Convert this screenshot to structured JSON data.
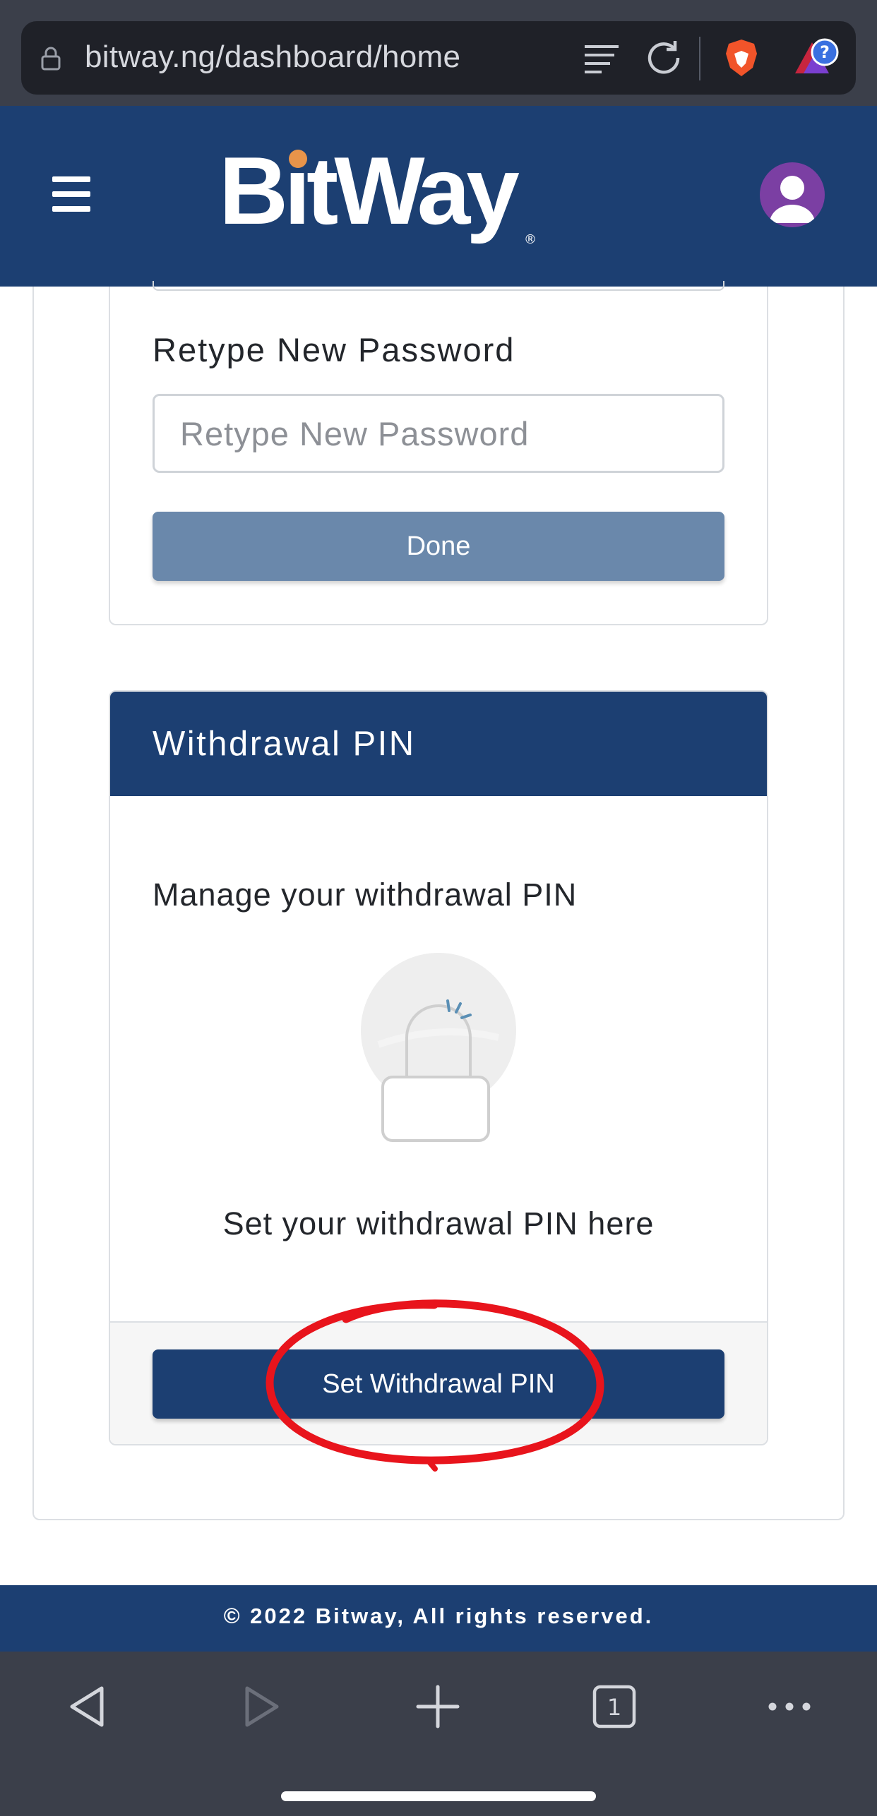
{
  "browser": {
    "url": "bitway.ng/dashboard/home",
    "tabs_count": "1"
  },
  "header": {
    "logo_text": "BitWay",
    "menu_icon": "hamburger-menu-icon",
    "avatar_icon": "user-avatar-icon"
  },
  "password_form": {
    "retype_label": "Retype New Password",
    "retype_placeholder": "Retype New Password",
    "retype_value": "",
    "done_label": "Done"
  },
  "withdrawal_pin": {
    "title": "Withdrawal PIN",
    "subtitle": "Manage your withdrawal PIN",
    "description": "Set your withdrawal PIN here",
    "button_label": "Set Withdrawal PIN",
    "illustration_icon": "padlock-icon"
  },
  "footer": {
    "copyright": "© 2022 Bitway, All rights reserved."
  },
  "colors": {
    "brand_navy": "#1c3f72",
    "done_button": "#6a88ab",
    "logo_accent": "#e8944a",
    "avatar_purple": "#7b3fa3",
    "annotation_red": "#e8141c"
  }
}
